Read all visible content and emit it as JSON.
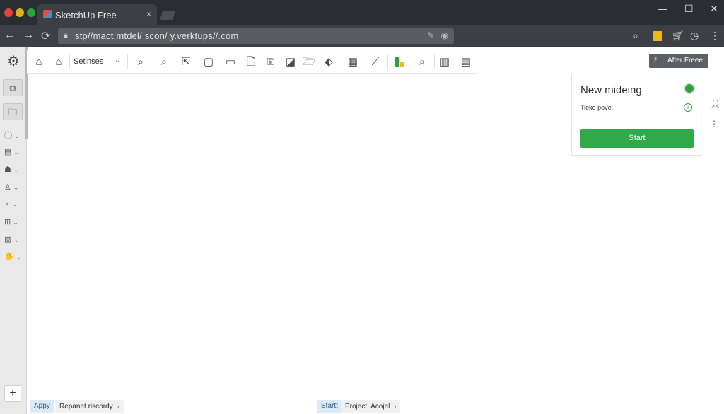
{
  "browser": {
    "tab_title": "SketchUp Free",
    "tab_close": "×",
    "url": "stp//mact.mtdel/ scon/ y.verktups//.com",
    "window_controls": [
      "—",
      "☐",
      "✕"
    ],
    "nav": [
      "←",
      "→",
      "⟳"
    ],
    "extensions": [
      "key-icon",
      "puzzle-icon",
      "cart-icon",
      "clock-icon",
      "menu-icon"
    ]
  },
  "leftrail": {
    "items": [
      {
        "icon": "ⓘ"
      },
      {
        "icon": "▤"
      },
      {
        "icon": "☗"
      },
      {
        "icon": "♙"
      },
      {
        "icon": "♀"
      },
      {
        "icon": "⊞"
      },
      {
        "icon": "▧"
      },
      {
        "icon": "✋"
      }
    ],
    "chevron": "⌄",
    "add": "+"
  },
  "toolbar": {
    "senses_label": "Setinses",
    "chevron": "⌄",
    "after_free": "After Freee"
  },
  "card": {
    "title": "New mideing",
    "subtitle": "Tieke povel",
    "start": "Start",
    "info": "i"
  },
  "bottom": {
    "left_primary": "Appy",
    "left_secondary": "Repanet riscordy",
    "right_primary": "Startt",
    "right_secondary": "Project: Acojel",
    "arrow": "›"
  }
}
